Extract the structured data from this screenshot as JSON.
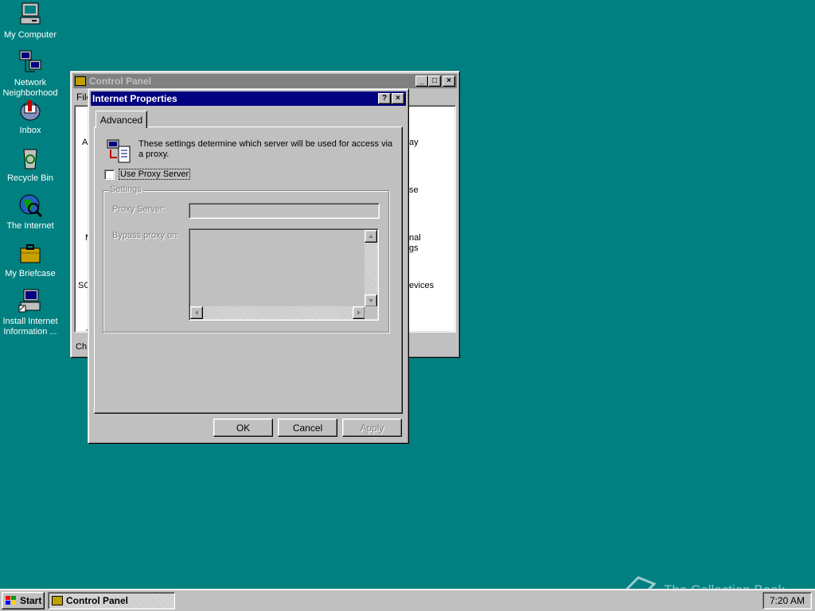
{
  "desktop": {
    "icons": [
      {
        "label_line1": "My Computer",
        "label_line2": ""
      },
      {
        "label_line1": "Network",
        "label_line2": "Neighborhood"
      },
      {
        "label_line1": "Inbox",
        "label_line2": ""
      },
      {
        "label_line1": "Recycle Bin",
        "label_line2": ""
      },
      {
        "label_line1": "The Internet",
        "label_line2": ""
      },
      {
        "label_line1": "My Briefcase",
        "label_line2": ""
      },
      {
        "label_line1": "Install Internet",
        "label_line2": "Information ..."
      }
    ]
  },
  "control_panel": {
    "title": "Control Panel",
    "menu_first": "File",
    "status_text": "Ch",
    "partial_labels": {
      "left": [
        "A",
        "M",
        "SC",
        "T"
      ],
      "right": [
        "ay",
        "se",
        "nal",
        "gs",
        "evices"
      ]
    }
  },
  "dialog": {
    "title": "Internet Properties",
    "help_button": "?",
    "close_button": "×",
    "tab": "Advanced",
    "description": "These settings determine which server will be used for access via a proxy.",
    "use_proxy_label": "Use Proxy Server",
    "use_proxy_checked": false,
    "settings_group": "Settings",
    "proxy_server_label": "Proxy Server:",
    "proxy_server_value": "",
    "bypass_label": "Bypass proxy on:",
    "bypass_value": "",
    "ok": "OK",
    "cancel": "Cancel",
    "apply": "Apply"
  },
  "taskbar": {
    "start": "Start",
    "task": "Control Panel",
    "clock": "7:20 AM"
  },
  "watermark": "The Collection Book",
  "colors": {
    "desktop": "#008080",
    "face": "#c0c0c0",
    "active_title": "#000080",
    "inactive_title": "#808080"
  }
}
